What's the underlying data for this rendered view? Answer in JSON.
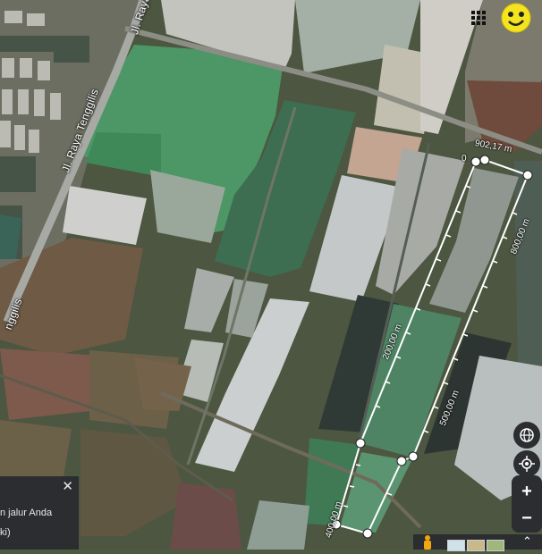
{
  "map": {
    "roads": [
      {
        "name": "Jl. Raya Tenggilis"
      },
      {
        "name": "Jl. Raya Tenggilis"
      },
      {
        "name": "nggilis"
      }
    ],
    "measurement": {
      "start_label": "0",
      "total_label": "902,17 m",
      "tick_labels": [
        "200,00 m",
        "400,00 m",
        "500,00 m",
        "800,00 m"
      ]
    }
  },
  "topbar": {
    "apps_icon": "grid-icon",
    "profile_icon": "smiley-avatar"
  },
  "controls": {
    "globe_icon": "globe-icon",
    "locate_icon": "crosshair-icon",
    "zoom_in_label": "+",
    "zoom_out_label": "−"
  },
  "panel": {
    "close_label": "✕",
    "line1": "n jalur Anda",
    "line2": "ki)"
  }
}
